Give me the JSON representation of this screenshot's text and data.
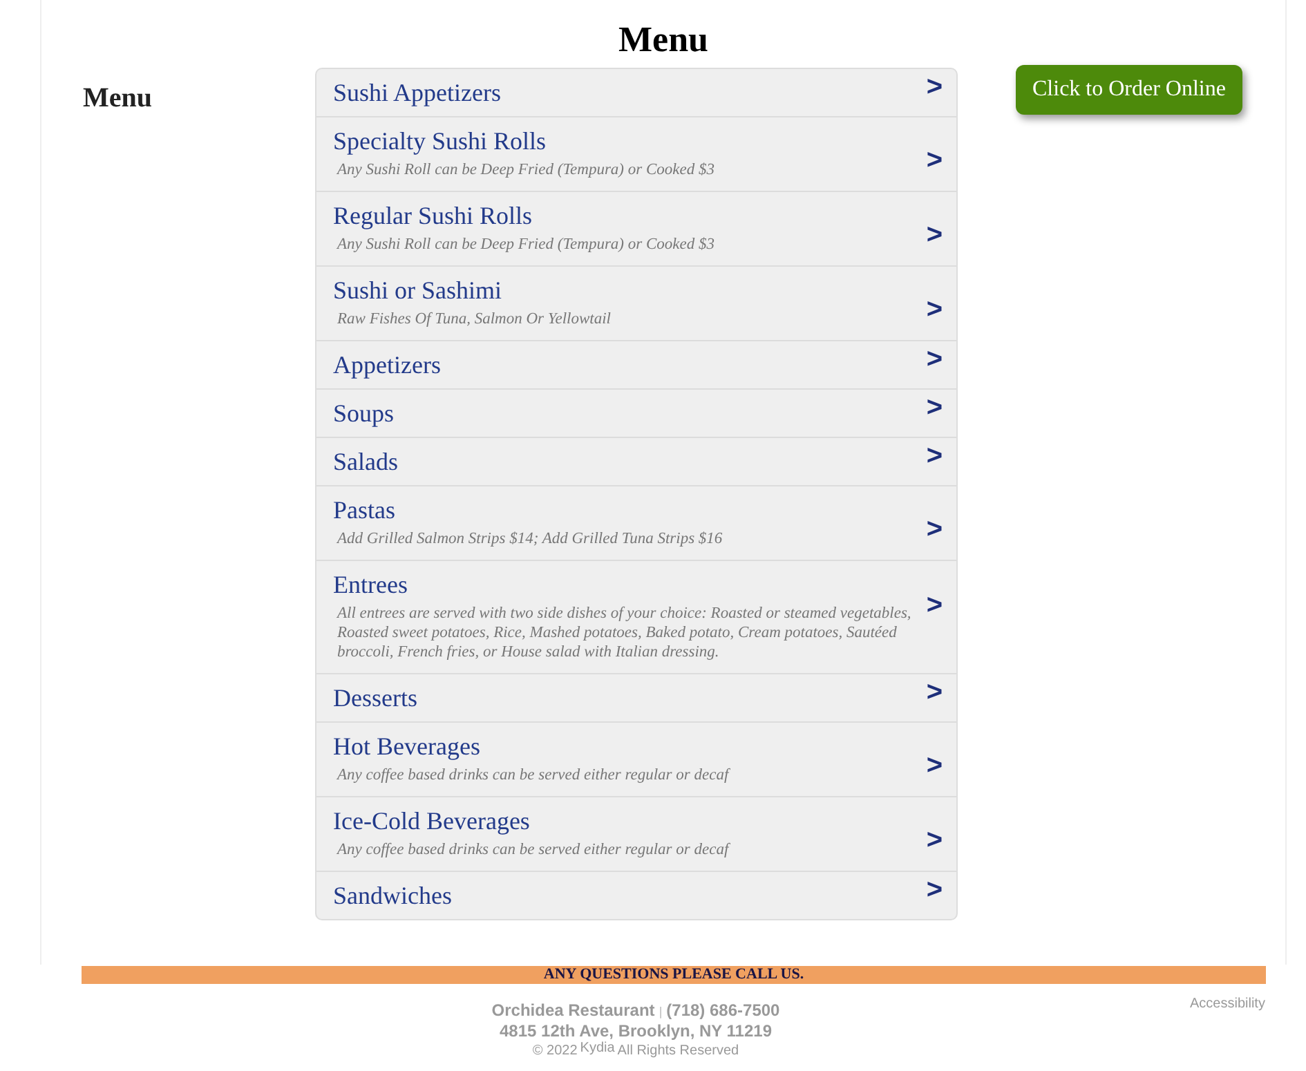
{
  "page_title": "Menu",
  "side_heading": "Menu",
  "order_button": "Click to Order Online",
  "categories": [
    {
      "name": "Sushi Appetizers",
      "arrow": ">"
    },
    {
      "name": "Specialty Sushi Rolls",
      "note": "Any Sushi Roll can be Deep Fried (Tempura) or Cooked $3",
      "arrow": ">"
    },
    {
      "name": "Regular Sushi Rolls",
      "note": "Any Sushi Roll can be Deep Fried (Tempura) or Cooked $3",
      "arrow": ">"
    },
    {
      "name": "Sushi or Sashimi",
      "note": "Raw Fishes Of Tuna, Salmon Or Yellowtail",
      "arrow": ">"
    },
    {
      "name": "Appetizers",
      "arrow": ">"
    },
    {
      "name": "Soups",
      "arrow": ">"
    },
    {
      "name": "Salads",
      "arrow": ">"
    },
    {
      "name": "Pastas",
      "note": "Add Grilled Salmon Strips $14; Add Grilled Tuna Strips $16",
      "arrow": ">"
    },
    {
      "name": "Entrees",
      "note": "All entrees are served with two side dishes of your choice: Roasted or steamed vegetables, Roasted sweet potatoes, Rice, Mashed potatoes, Baked potato, Cream potatoes, Sautéed broccoli, French fries, or House salad with Italian dressing.",
      "arrow": ">"
    },
    {
      "name": "Desserts",
      "arrow": ">"
    },
    {
      "name": "Hot Beverages",
      "note": "Any coffee based drinks can be served either regular or decaf",
      "arrow": ">"
    },
    {
      "name": "Ice-Cold Beverages",
      "note": "Any coffee based drinks can be served either regular or decaf",
      "arrow": ">"
    },
    {
      "name": "Sandwiches",
      "arrow": ">"
    }
  ],
  "banner": "ANY QUESTIONS PLEASE CALL US.",
  "footer": {
    "restaurant": "Orchidea Restaurant",
    "separator": "|",
    "phone": "(718) 686-7500",
    "address": "4815 12th Ave, Brooklyn, NY 11219",
    "copyright": "© 2022",
    "brand": "Kydia",
    "rights": "All Rights Reserved",
    "accessibility": "Accessibility"
  }
}
